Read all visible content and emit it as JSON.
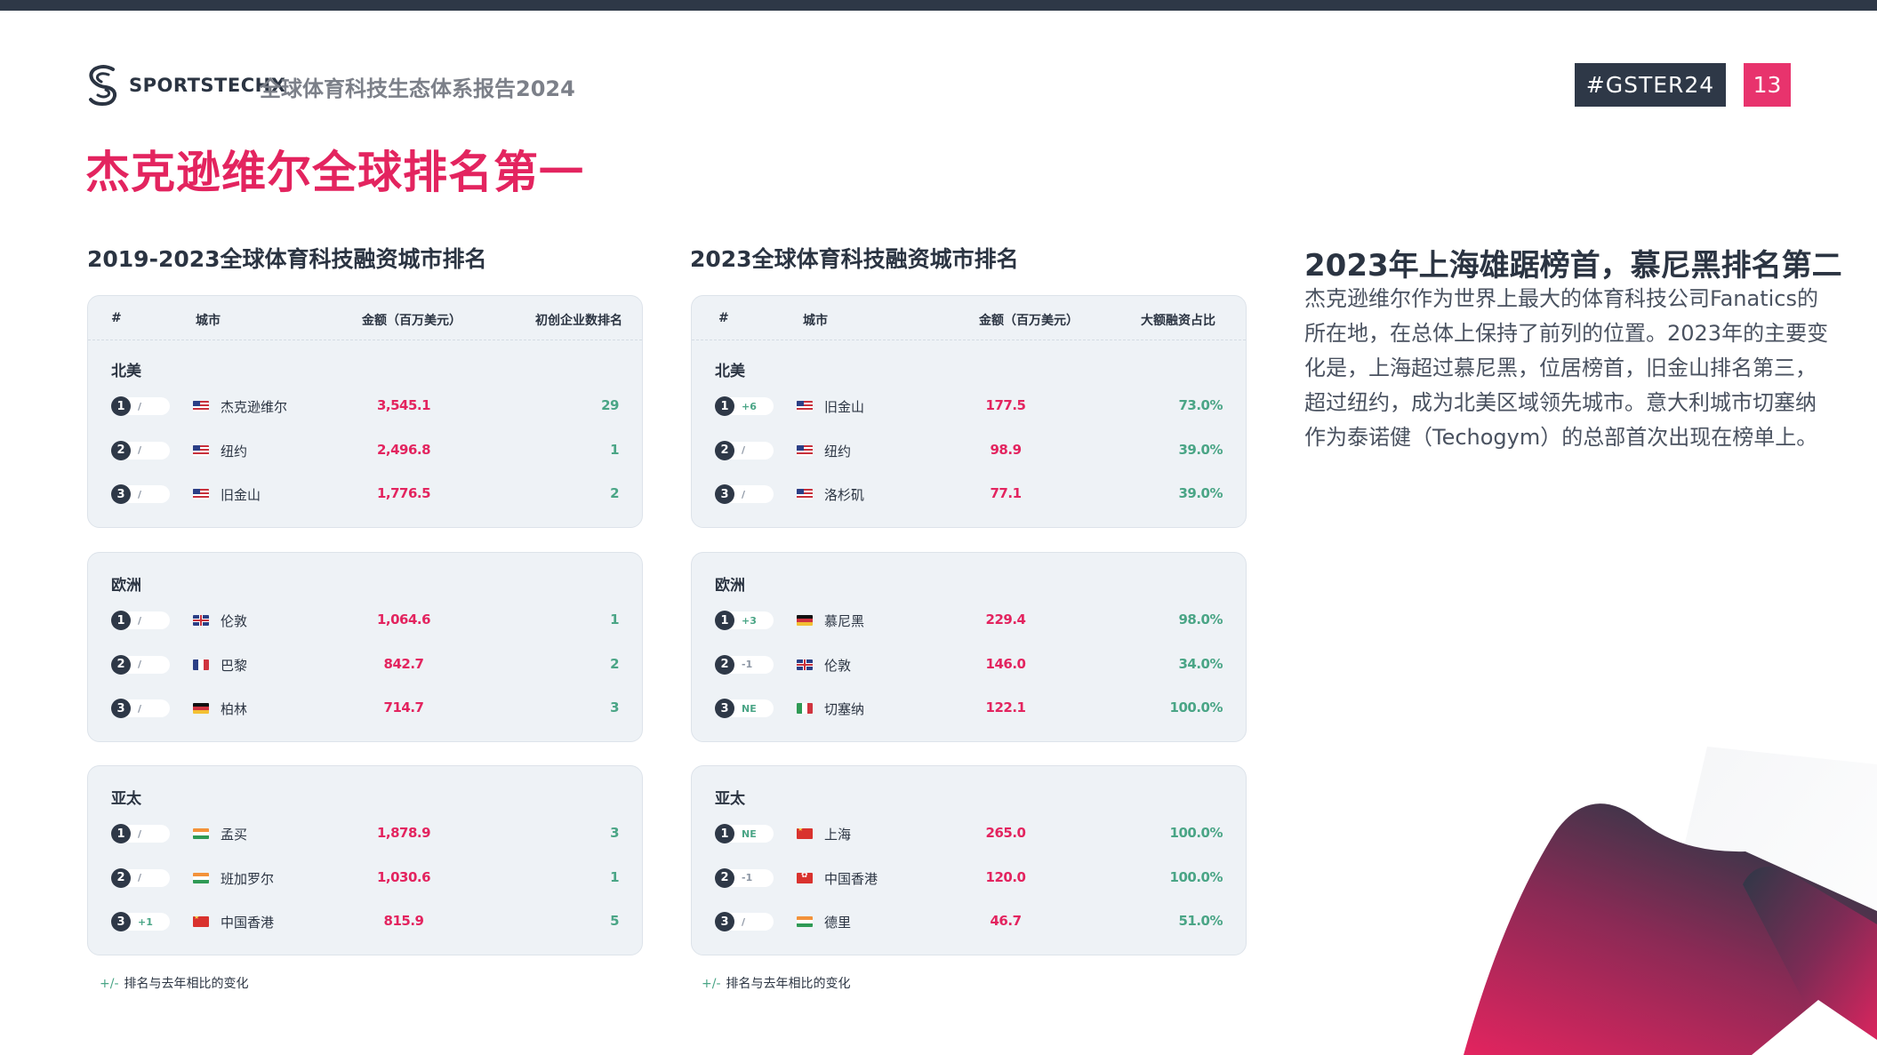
{
  "header": {
    "brand": "SPORTSTECHX",
    "report_title": "全球体育科技生态体系报告2024",
    "hashtag": "#GSTER24",
    "page_number": "13"
  },
  "headline": "杰克逊维尔全球排名第一",
  "left": {
    "title": "2019-2023全球体育科技融资城市排名",
    "columns": [
      "#",
      "城市",
      "金额（百万美元）",
      "初创企业数排名"
    ],
    "regions": [
      {
        "name": "北美",
        "rows": [
          {
            "rank": "1",
            "change": "/",
            "flag": "us",
            "city": "杰克逊维尔",
            "amount": "3,545.1",
            "value": "29"
          },
          {
            "rank": "2",
            "change": "/",
            "flag": "us",
            "city": "纽约",
            "amount": "2,496.8",
            "value": "1"
          },
          {
            "rank": "3",
            "change": "/",
            "flag": "us",
            "city": "旧金山",
            "amount": "1,776.5",
            "value": "2"
          }
        ]
      },
      {
        "name": "欧洲",
        "rows": [
          {
            "rank": "1",
            "change": "/",
            "flag": "uk",
            "city": "伦敦",
            "amount": "1,064.6",
            "value": "1"
          },
          {
            "rank": "2",
            "change": "/",
            "flag": "fr",
            "city": "巴黎",
            "amount": "842.7",
            "value": "2"
          },
          {
            "rank": "3",
            "change": "/",
            "flag": "de",
            "city": "柏林",
            "amount": "714.7",
            "value": "3"
          }
        ]
      },
      {
        "name": "亚太",
        "rows": [
          {
            "rank": "1",
            "change": "/",
            "flag": "in",
            "city": "孟买",
            "amount": "1,878.9",
            "value": "3"
          },
          {
            "rank": "2",
            "change": "/",
            "flag": "in",
            "city": "班加罗尔",
            "amount": "1,030.6",
            "value": "1"
          },
          {
            "rank": "3",
            "change": "+1",
            "flag": "cn",
            "city": "中国香港",
            "amount": "815.9",
            "value": "5"
          }
        ]
      }
    ],
    "note_symbol": "+/-",
    "note": "排名与去年相比的变化"
  },
  "middle": {
    "title": "2023全球体育科技融资城市排名",
    "columns": [
      "#",
      "城市",
      "金额（百万美元）",
      "大额融资占比"
    ],
    "regions": [
      {
        "name": "北美",
        "rows": [
          {
            "rank": "1",
            "change": "+6",
            "flag": "us",
            "city": "旧金山",
            "amount": "177.5",
            "value": "73.0%"
          },
          {
            "rank": "2",
            "change": "/",
            "flag": "us",
            "city": "纽约",
            "amount": "98.9",
            "value": "39.0%"
          },
          {
            "rank": "3",
            "change": "/",
            "flag": "us",
            "city": "洛杉矶",
            "amount": "77.1",
            "value": "39.0%"
          }
        ]
      },
      {
        "name": "欧洲",
        "rows": [
          {
            "rank": "1",
            "change": "+3",
            "flag": "de",
            "city": "慕尼黑",
            "amount": "229.4",
            "value": "98.0%"
          },
          {
            "rank": "2",
            "change": "-1",
            "flag": "uk",
            "city": "伦敦",
            "amount": "146.0",
            "value": "34.0%"
          },
          {
            "rank": "3",
            "change": "NE",
            "flag": "it",
            "city": "切塞纳",
            "amount": "122.1",
            "value": "100.0%"
          }
        ]
      },
      {
        "name": "亚太",
        "rows": [
          {
            "rank": "1",
            "change": "NE",
            "flag": "cn",
            "city": "上海",
            "amount": "265.0",
            "value": "100.0%"
          },
          {
            "rank": "2",
            "change": "-1",
            "flag": "hk",
            "city": "中国香港",
            "amount": "120.0",
            "value": "100.0%"
          },
          {
            "rank": "3",
            "change": "/",
            "flag": "in",
            "city": "德里",
            "amount": "46.7",
            "value": "51.0%"
          }
        ]
      }
    ],
    "note_symbol": "+/-",
    "note": "排名与去年相比的变化"
  },
  "right": {
    "title": "2023年上海雄踞榜首，慕尼黑排名第二",
    "body": "杰克逊维尔作为世界上最大的体育科技公司Fanatics的所在地，在总体上保持了前列的位置。2023年的主要变化是，上海超过慕尼黑，位居榜首，旧金山排名第三，超过纽约，成为北美区域领先城市。意大利城市切塞纳作为泰诺健（Techogym）的总部首次出现在榜单上。"
  },
  "colors": {
    "accent_pink": "#e3245f",
    "dark": "#2e3847",
    "green": "#4aa586",
    "card_bg": "#eef2f6"
  }
}
